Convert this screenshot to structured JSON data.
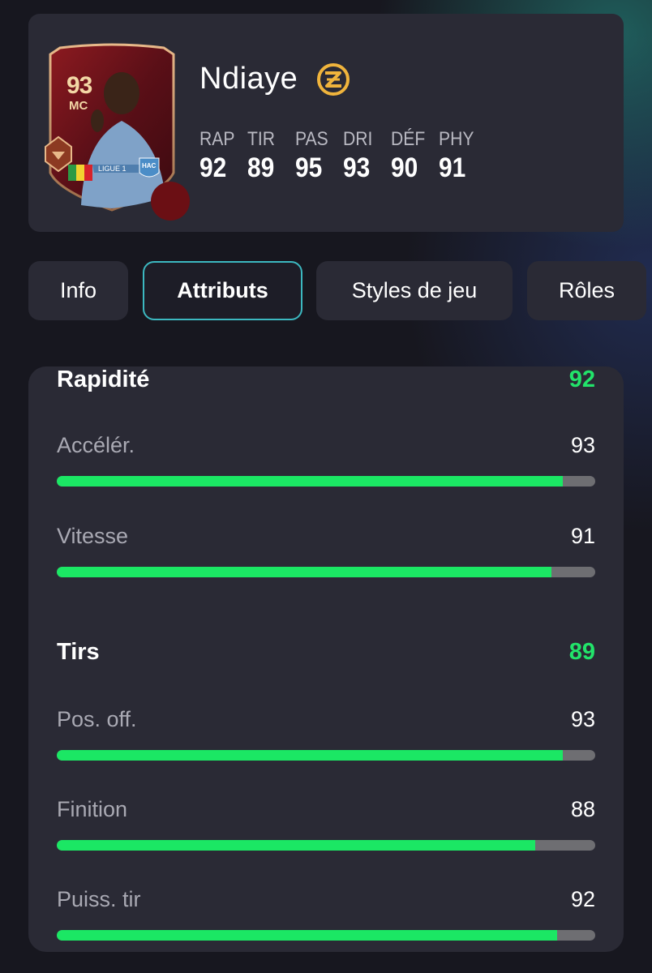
{
  "player": {
    "name": "Ndiaye",
    "card_rating": "93",
    "card_position": "MC",
    "card_league": "LIGUE 1",
    "card_club": "HAC",
    "stats": [
      {
        "label": "RAP",
        "value": "92"
      },
      {
        "label": "TIR",
        "value": "89"
      },
      {
        "label": "PAS",
        "value": "95"
      },
      {
        "label": "DRI",
        "value": "93"
      },
      {
        "label": "DÉF",
        "value": "90"
      },
      {
        "label": "PHY",
        "value": "91"
      }
    ]
  },
  "tabs": [
    {
      "label": "Info",
      "active": false
    },
    {
      "label": "Attributs",
      "active": true
    },
    {
      "label": "Styles de jeu",
      "active": false
    },
    {
      "label": "Rôles",
      "active": false
    }
  ],
  "attributes": {
    "groups": [
      {
        "title": "Rapidité",
        "value": "92",
        "items": [
          {
            "name": "Accélér.",
            "value": "93"
          },
          {
            "name": "Vitesse",
            "value": "91"
          }
        ]
      },
      {
        "title": "Tirs",
        "value": "89",
        "items": [
          {
            "name": "Pos. off.",
            "value": "93"
          },
          {
            "name": "Finition",
            "value": "88"
          },
          {
            "name": "Puiss. tir",
            "value": "92"
          }
        ]
      }
    ]
  },
  "colors": {
    "accent_green": "#22e36a",
    "bar_fill": "#1be764",
    "active_tab_border": "#3cb8c0",
    "evolution_badge": "#f0b43c"
  },
  "icons": {
    "evolution_badge": "evolution-icon",
    "nationality_flag": "senegal-flag-icon"
  }
}
